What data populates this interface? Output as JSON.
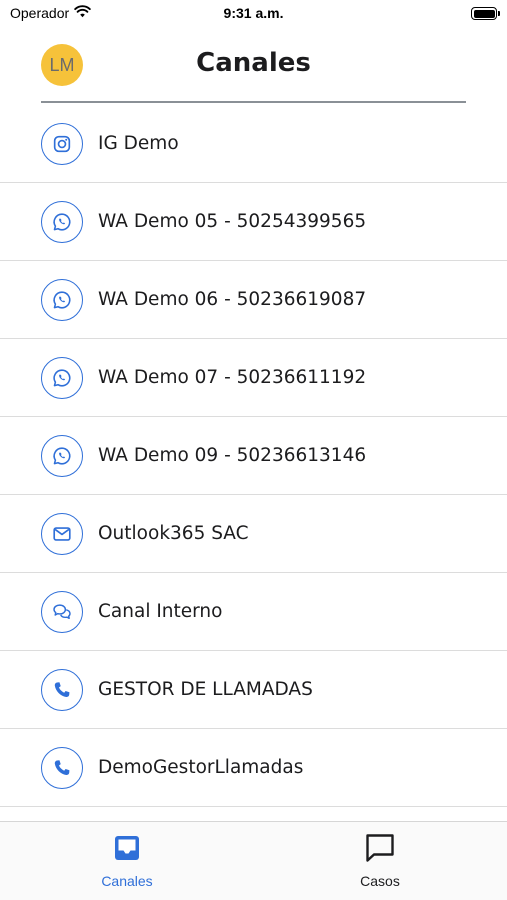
{
  "status_bar": {
    "carrier": "Operador",
    "time": "9:31 a.m."
  },
  "header": {
    "avatar_initials": "LM",
    "title": "Canales"
  },
  "channels": [
    {
      "label": "IG Demo",
      "icon": "instagram-icon"
    },
    {
      "label": "WA Demo 05 - 50254399565",
      "icon": "whatsapp-icon"
    },
    {
      "label": "WA Demo 06 - 50236619087",
      "icon": "whatsapp-icon"
    },
    {
      "label": "WA Demo 07 - 50236611192",
      "icon": "whatsapp-icon"
    },
    {
      "label": "WA Demo 09 - 50236613146",
      "icon": "whatsapp-icon"
    },
    {
      "label": "Outlook365 SAC",
      "icon": "mail-icon"
    },
    {
      "label": "Canal Interno",
      "icon": "chat-bubbles-icon"
    },
    {
      "label": "GESTOR DE LLAMADAS",
      "icon": "phone-icon"
    },
    {
      "label": "DemoGestorLlamadas",
      "icon": "phone-icon"
    }
  ],
  "tab_bar": {
    "tabs": [
      {
        "label": "Canales",
        "icon": "inbox-icon",
        "active": true
      },
      {
        "label": "Casos",
        "icon": "message-icon",
        "active": false
      }
    ]
  },
  "colors": {
    "accent": "#2f6fd8",
    "avatar": "#f6c23a",
    "divider": "#dcdcdc"
  }
}
